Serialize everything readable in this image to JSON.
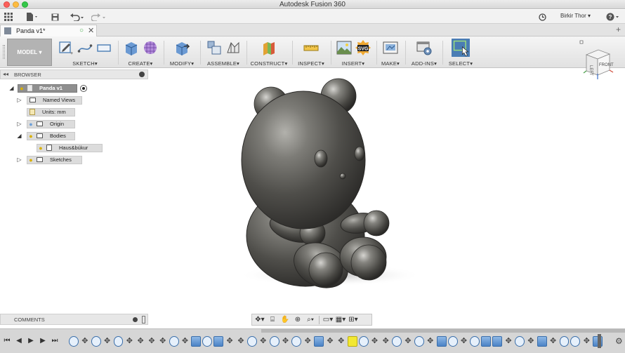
{
  "window": {
    "title": "Autodesk Fusion 360"
  },
  "quick_access": {
    "icons": [
      "grid-menu-icon",
      "file-icon",
      "save-icon",
      "undo-icon",
      "redo-icon"
    ],
    "user": "Birkir Thor",
    "help": "?"
  },
  "document_tab": {
    "label": "Panda v1*"
  },
  "ribbon": {
    "workspace": "MODEL",
    "groups": [
      {
        "label": "SKETCH",
        "arrow": "▾"
      },
      {
        "label": "CREATE",
        "arrow": "▾"
      },
      {
        "label": "MODIFY",
        "arrow": "▾"
      },
      {
        "label": "ASSEMBLE",
        "arrow": "▾"
      },
      {
        "label": "CONSTRUCT",
        "arrow": "▾"
      },
      {
        "label": "INSPECT",
        "arrow": "▾"
      },
      {
        "label": "INSERT",
        "arrow": "▾"
      },
      {
        "label": "MAKE",
        "arrow": "▾"
      },
      {
        "label": "ADD-INS",
        "arrow": "▾"
      },
      {
        "label": "SELECT",
        "arrow": "▾"
      }
    ]
  },
  "browser": {
    "title": "BROWSER",
    "root": "Panda v1",
    "nodes": [
      {
        "label": "Named Views"
      },
      {
        "label": "Units: mm"
      },
      {
        "label": "Origin"
      },
      {
        "label": "Bodies"
      },
      {
        "label": "Haus&búkur"
      },
      {
        "label": "Sketches"
      }
    ]
  },
  "viewcube": {
    "top": "TOP",
    "front": "FRONT",
    "left": "LEFT"
  },
  "comments": {
    "title": "COMMENTS"
  },
  "colors": {
    "accent": "#4a7db4",
    "model": "#4e4d4a",
    "highlight": "#f2e832"
  }
}
